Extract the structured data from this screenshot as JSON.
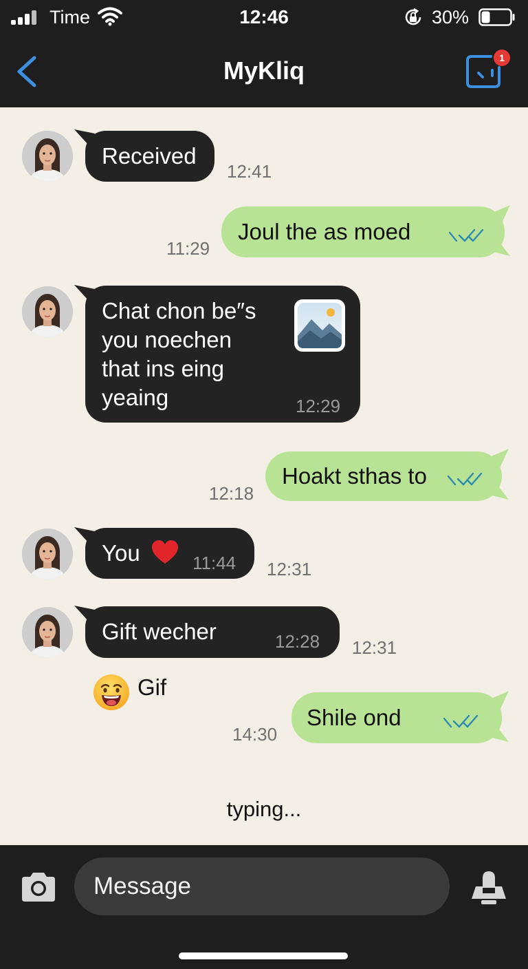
{
  "status_bar": {
    "carrier": "Time",
    "time": "12:46",
    "battery_percent": "30%",
    "battery_level": 0.3,
    "icons": [
      "signal-icon",
      "wifi-icon",
      "rotation-lock-icon",
      "battery-icon"
    ]
  },
  "header": {
    "title": "MyKliq",
    "back_icon": "chevron-left-icon",
    "compose_icon": "compose-icon",
    "badge_count": "1",
    "accent_color": "#3d8fe0",
    "badge_color": "#e53935"
  },
  "colors": {
    "background": "#f4efe6",
    "incoming_bubble": "#232323",
    "outgoing_bubble": "#b9e394",
    "bars": "#1e1e1e"
  },
  "messages": [
    {
      "direction": "incoming",
      "text": "Received",
      "time": "12:41"
    },
    {
      "direction": "outgoing",
      "text": "Joul the as moed",
      "time": "11:29",
      "status": "read"
    },
    {
      "direction": "incoming",
      "text_lines": [
        "Chat chon be″s",
        "you noechen",
        "that ins eing",
        "yeaing"
      ],
      "time": "12:29",
      "attachment": "image-icon"
    },
    {
      "direction": "outgoing",
      "text": "Hoakt sthas to",
      "time": "12:18",
      "status": "read"
    },
    {
      "direction": "incoming",
      "text": "You",
      "emoji": "heart-icon",
      "inner_time": "11:44",
      "time": "12:31"
    },
    {
      "direction": "incoming",
      "text": "Gift wecher",
      "inner_time": "12:28",
      "time": "12:31"
    },
    {
      "direction": "incoming",
      "type": "gif",
      "emoji": "grinning-face-icon",
      "label": "Gif"
    },
    {
      "direction": "outgoing",
      "text": "Shile ond",
      "time": "14:30",
      "status": "read"
    }
  ],
  "typing_indicator": "typing...",
  "composer": {
    "placeholder": "Message",
    "camera_icon": "camera-icon",
    "mic_icon": "microphone-icon"
  }
}
